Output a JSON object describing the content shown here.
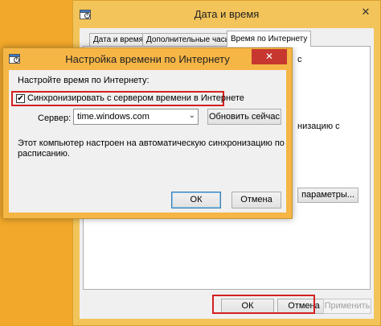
{
  "back_window": {
    "title": "Дата и время",
    "close_glyph": "✕",
    "tabs": [
      {
        "label": "Дата и время",
        "active": false
      },
      {
        "label": "Дополнительные часы",
        "active": false
      },
      {
        "label": "Время по Интернету",
        "active": true
      }
    ],
    "partial_text_1": "с",
    "partial_text_2": "низацию с",
    "parameters_button": "параметры...",
    "ok_button": "ОК",
    "cancel_button": "Отмена",
    "apply_button": "Применить"
  },
  "dialog": {
    "title": "Настройка времени по Интернету",
    "close_glyph": "✕",
    "section_label": "Настройте время по Интернету:",
    "sync_checkbox_label": "Синхронизировать с сервером времени в Интернете",
    "sync_checked": true,
    "check_glyph": "✔",
    "server_label": "Сервер:",
    "server_value": "time.windows.com",
    "dropdown_glyph": "⌄",
    "update_button": "Обновить сейчас",
    "info_text_line1": "Этот компьютер настроен на автоматическую синхронизацию по",
    "info_text_line2": "расписанию.",
    "ok_button": "ОК",
    "cancel_button": "Отмена"
  },
  "colors": {
    "desktop": "#f2a82a",
    "highlight": "#d42020",
    "close_button": "#c7372f"
  },
  "icons": {
    "app_icon": "clock-calendar-icon"
  }
}
